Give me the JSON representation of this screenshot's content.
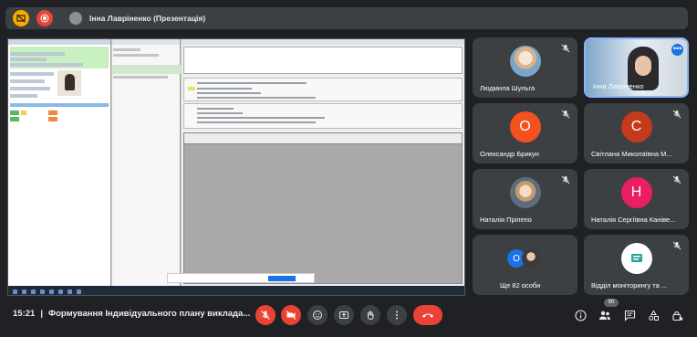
{
  "presenter": {
    "title": "Інна Лавріненко (Презентація)"
  },
  "participants": [
    {
      "name": "Людмила Шульга",
      "mic": "muted",
      "avatar_type": "photo"
    },
    {
      "name": "Інна Лавріненко",
      "mic": "active",
      "avatar_type": "video"
    },
    {
      "name": "Олександр Брикун",
      "mic": "muted",
      "avatar_type": "letter",
      "initial": "О",
      "color": "#f4511e"
    },
    {
      "name": "Світлана Миколаївна М...",
      "mic": "muted",
      "avatar_type": "letter",
      "initial": "С",
      "color": "#c5391d"
    },
    {
      "name": "Наталія Пріпепо",
      "mic": "muted",
      "avatar_type": "photo"
    },
    {
      "name": "Наталія Сергіївна Каніве...",
      "mic": "muted",
      "avatar_type": "letter",
      "initial": "Н",
      "color": "#e91e63"
    },
    {
      "name": "Ще 82 особи",
      "avatar_type": "stack",
      "initial": "О",
      "color": "#1a73e8"
    },
    {
      "name": "Відділ моніторингу та ...",
      "mic": "muted",
      "avatar_type": "logo"
    }
  ],
  "bottom": {
    "time": "15:21",
    "separator": "|",
    "meeting_title": "Формування Індивідуального плану виклада...",
    "participants_count": "90"
  },
  "colors": {
    "background": "#202124",
    "tile": "#3c4043",
    "danger": "#ea4335",
    "accent": "#1a73e8",
    "active_border": "#8ab4f8"
  },
  "icons": {
    "present_stop": "present-icon",
    "record": "record-icon",
    "mic": "mic-off-icon",
    "camera": "camera-off-icon",
    "emoji": "emoji-icon",
    "present": "present-screen-icon",
    "hand": "raise-hand-icon",
    "more": "more-vert-icon",
    "end": "end-call-icon",
    "info": "info-icon",
    "people": "people-icon",
    "chat": "chat-icon",
    "activities": "activities-icon",
    "lock": "host-controls-icon"
  }
}
